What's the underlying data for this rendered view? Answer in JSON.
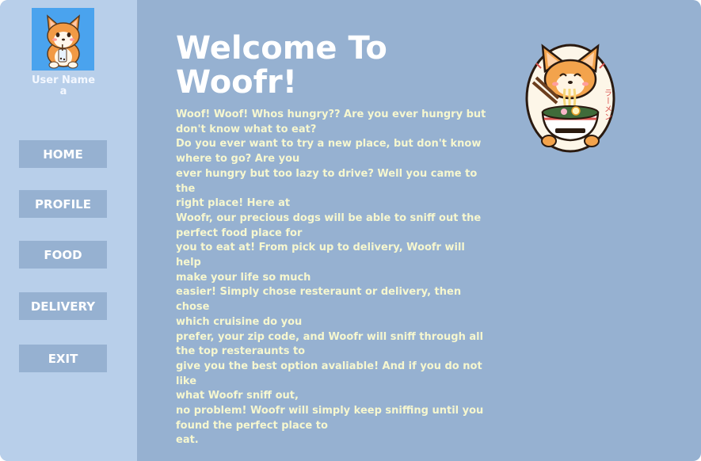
{
  "sidebar": {
    "user_name_label": "User Name",
    "user_name_value": "a",
    "avatar_icon": "corgi-boba-avatar-icon",
    "nav": [
      {
        "label": "HOME"
      },
      {
        "label": "PROFILE"
      },
      {
        "label": "FOOD"
      },
      {
        "label": "DELIVERY"
      },
      {
        "label": "EXIT"
      }
    ]
  },
  "main": {
    "title_line1": "Welcome To",
    "title_line2": "Woofr!",
    "body_lines": [
      "Woof! Woof! Whos hungry?? Are you ever hungry but",
      "don't know what to eat?",
      "Do you ever want to try a new place, but don't know",
      "where to go? Are you",
      "ever hungry but too lazy to drive? Well you came to the",
      "right place! Here at",
      "Woofr, our precious dogs will be able to sniff out the",
      "perfect food place for",
      "you to eat at! From pick up to delivery, Woofr will help",
      "make your life so much",
      "easier! Simply chose resteraunt or delivery, then chose",
      "which cruisine do you",
      "prefer, your zip code, and Woofr will sniff through all",
      "the top resteraunts to",
      "give you the best option avaliable! And if you do not like",
      "what Woofr sniff out,",
      "no problem! Woofr will simply keep sniffing until you",
      "found the perfect place to",
      "eat."
    ],
    "mascot_icon": "corgi-ramen-logo-icon",
    "mascot_text": "ラーメン"
  },
  "colors": {
    "sidebar_bg": "#b8cfea",
    "main_bg": "#96b1d1",
    "button_bg": "#96b1d1",
    "title": "#ffffff",
    "body_text": "#f6f7cf",
    "avatar_bg": "#4aa3ee"
  }
}
